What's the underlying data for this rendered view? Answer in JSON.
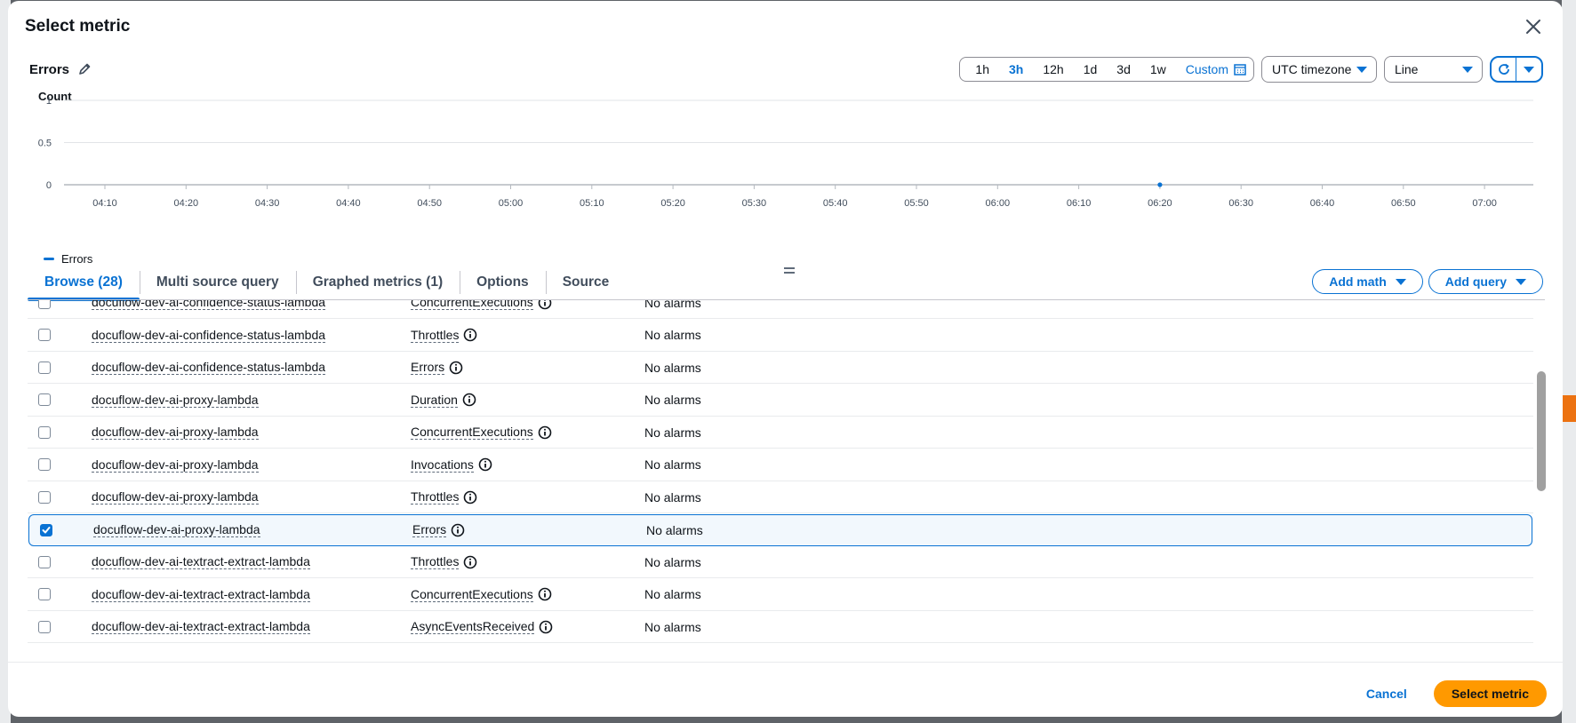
{
  "modal": {
    "title": "Select metric"
  },
  "metric": {
    "title": "Errors"
  },
  "time_ranges": [
    "1h",
    "3h",
    "12h",
    "1d",
    "3d",
    "1w"
  ],
  "time_range_selected": "3h",
  "custom_label": "Custom",
  "timezone": "UTC timezone",
  "chart_type": "Line",
  "chart_data": {
    "type": "line",
    "title": "",
    "ylabel": "Count",
    "ylim": [
      0,
      1
    ],
    "yticks": [
      "0",
      "0.5",
      "1"
    ],
    "x_ticks": [
      "04:10",
      "04:20",
      "04:30",
      "04:40",
      "04:50",
      "05:00",
      "05:10",
      "05:20",
      "05:30",
      "05:40",
      "05:50",
      "06:00",
      "06:10",
      "06:20",
      "06:30",
      "06:40",
      "06:50",
      "07:00"
    ],
    "series": [
      {
        "name": "Errors",
        "color": "#0972d3",
        "points": [
          {
            "x": "06:20",
            "y": 0
          }
        ]
      }
    ],
    "legend_position": "bottom-left"
  },
  "tabs": [
    {
      "label": "Browse (28)",
      "active": true
    },
    {
      "label": "Multi source query",
      "active": false
    },
    {
      "label": "Graphed metrics (1)",
      "active": false
    },
    {
      "label": "Options",
      "active": false
    },
    {
      "label": "Source",
      "active": false
    }
  ],
  "actions": {
    "add_math": "Add math",
    "add_query": "Add query"
  },
  "rows": [
    {
      "function": "docuflow-dev-ai-confidence-status-lambda",
      "metric": "ConcurrentExecutions",
      "alarms": "No alarms",
      "checked": false
    },
    {
      "function": "docuflow-dev-ai-confidence-status-lambda",
      "metric": "Throttles",
      "alarms": "No alarms",
      "checked": false
    },
    {
      "function": "docuflow-dev-ai-confidence-status-lambda",
      "metric": "Errors",
      "alarms": "No alarms",
      "checked": false
    },
    {
      "function": "docuflow-dev-ai-proxy-lambda",
      "metric": "Duration",
      "alarms": "No alarms",
      "checked": false
    },
    {
      "function": "docuflow-dev-ai-proxy-lambda",
      "metric": "ConcurrentExecutions",
      "alarms": "No alarms",
      "checked": false
    },
    {
      "function": "docuflow-dev-ai-proxy-lambda",
      "metric": "Invocations",
      "alarms": "No alarms",
      "checked": false
    },
    {
      "function": "docuflow-dev-ai-proxy-lambda",
      "metric": "Throttles",
      "alarms": "No alarms",
      "checked": false
    },
    {
      "function": "docuflow-dev-ai-proxy-lambda",
      "metric": "Errors",
      "alarms": "No alarms",
      "checked": true
    },
    {
      "function": "docuflow-dev-ai-textract-extract-lambda",
      "metric": "Throttles",
      "alarms": "No alarms",
      "checked": false
    },
    {
      "function": "docuflow-dev-ai-textract-extract-lambda",
      "metric": "ConcurrentExecutions",
      "alarms": "No alarms",
      "checked": false
    },
    {
      "function": "docuflow-dev-ai-textract-extract-lambda",
      "metric": "AsyncEventsReceived",
      "alarms": "No alarms",
      "checked": false
    }
  ],
  "footer": {
    "cancel": "Cancel",
    "select": "Select metric"
  },
  "colors": {
    "accent": "#0972d3",
    "primary_button": "#ff9900"
  }
}
